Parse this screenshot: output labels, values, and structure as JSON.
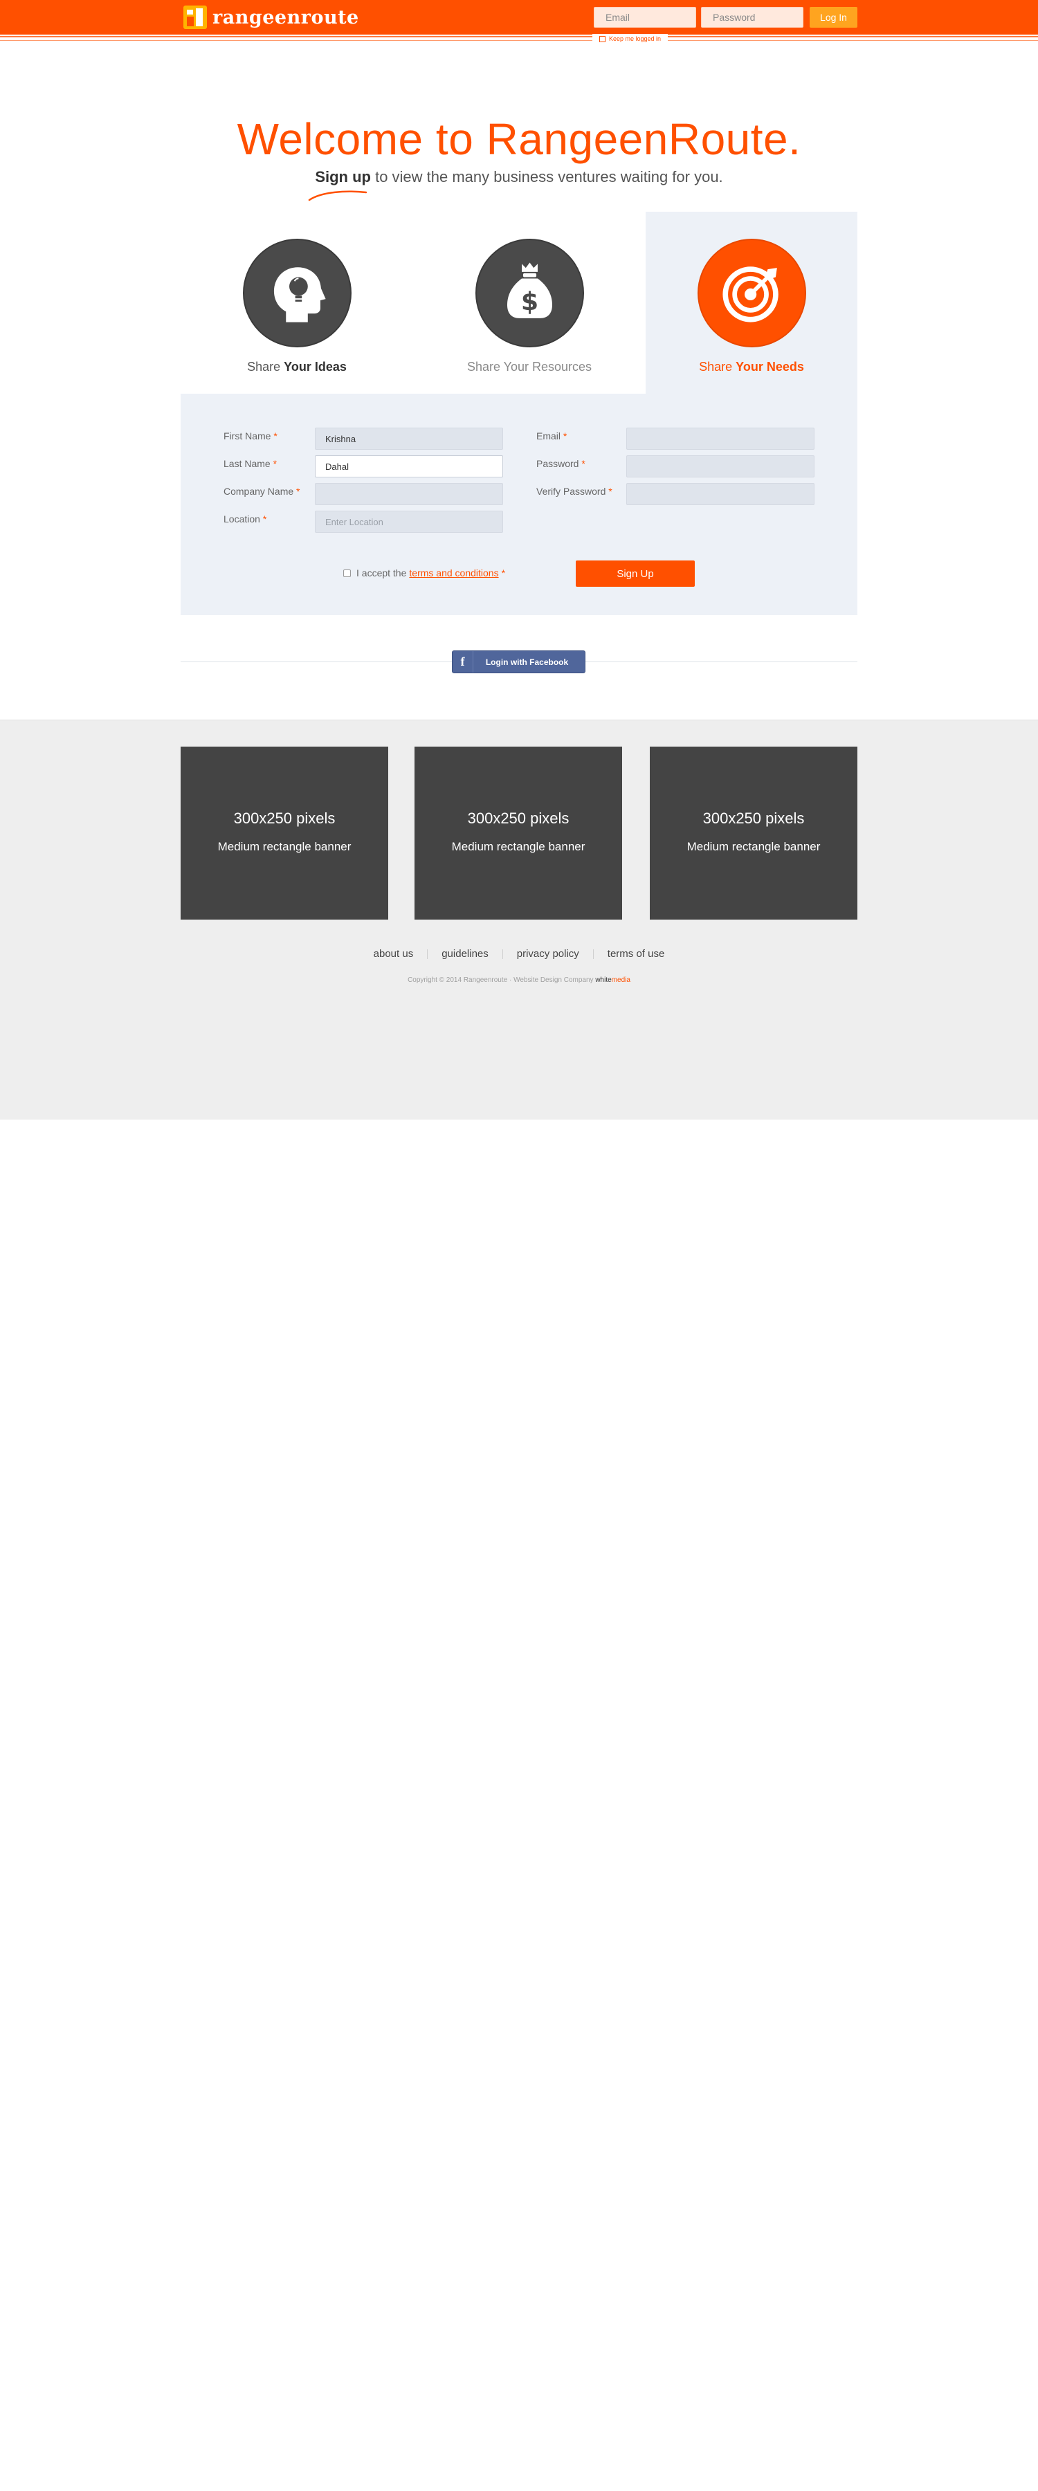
{
  "header": {
    "logo_text": "rangeenroute",
    "email_placeholder": "Email",
    "password_placeholder": "Password",
    "login_label": "Log In",
    "keep_logged_in": "Keep me logged in"
  },
  "hero": {
    "title": "Welcome to RangeenRoute.",
    "signup_bold": "Sign up",
    "tagline_rest": " to view the many business ventures waiting for you."
  },
  "tabs": [
    {
      "prefix": "Share ",
      "bold": "Your Ideas",
      "icon": "head-lightbulb-icon"
    },
    {
      "prefix": "Share Your Resources",
      "bold": "",
      "icon": "money-bag-icon"
    },
    {
      "prefix": "Share ",
      "bold": "Your Needs",
      "icon": "target-icon"
    }
  ],
  "form": {
    "first_name_label": "First Name",
    "first_name_value": "Krishna",
    "last_name_label": "Last Name",
    "last_name_value": "Dahal",
    "company_label": "Company Name",
    "company_value": "",
    "location_label": "Location",
    "location_placeholder": "Enter Location",
    "email_label": "Email",
    "password_label": "Password",
    "verify_label": "Verify Password",
    "required_mark": "*",
    "terms_prefix": "I accept the",
    "terms_link": "terms and conditions",
    "signup_label": "Sign Up"
  },
  "facebook": {
    "label": "Login with Facebook",
    "icon_glyph": "f"
  },
  "banners": [
    {
      "size": "300x250 pixels",
      "name": "Medium rectangle banner"
    },
    {
      "size": "300x250 pixels",
      "name": "Medium rectangle banner"
    },
    {
      "size": "300x250 pixels",
      "name": "Medium rectangle banner"
    }
  ],
  "footer": {
    "links": [
      "about us",
      "guidelines",
      "privacy policy",
      "terms of use"
    ],
    "copyright": "Copyright © 2014 Rangeenroute · Website Design Company",
    "brand_a": "white",
    "brand_b": "media"
  },
  "colors": {
    "brand_orange": "#ff5000",
    "login_button": "#ffa41f",
    "panel_bg": "#edf1f7",
    "dark_circle": "#4a4a4a",
    "facebook_blue": "#50669b"
  }
}
